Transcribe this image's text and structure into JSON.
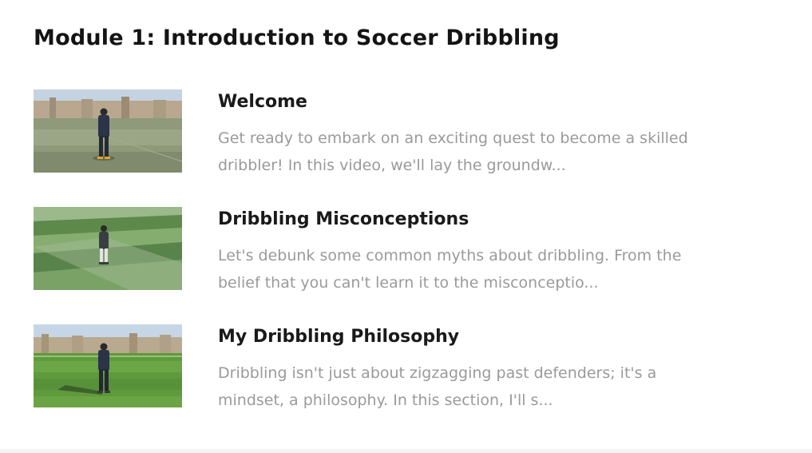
{
  "module": {
    "title": "Module 1: Introduction to Soccer Dribbling"
  },
  "lessons": [
    {
      "title": "Welcome",
      "description": "Get ready to embark on an exciting quest to become a skilled dribbler! In this video, we'll lay the groundw...",
      "thumbnail_icon": "video-thumbnail"
    },
    {
      "title": "Dribbling Misconceptions",
      "description": "Let's debunk some common myths about dribbling. From the belief that you can't learn it to the misconceptio...",
      "thumbnail_icon": "video-thumbnail"
    },
    {
      "title": "My Dribbling Philosophy",
      "description": "Dribbling isn't just about zigzagging past defenders; it's a mindset, a philosophy. In this section, I'll s...",
      "thumbnail_icon": "video-thumbnail"
    }
  ],
  "colors": {
    "title": "#141414",
    "lesson_title": "#1a1a1a",
    "description": "#9a9a9a"
  }
}
